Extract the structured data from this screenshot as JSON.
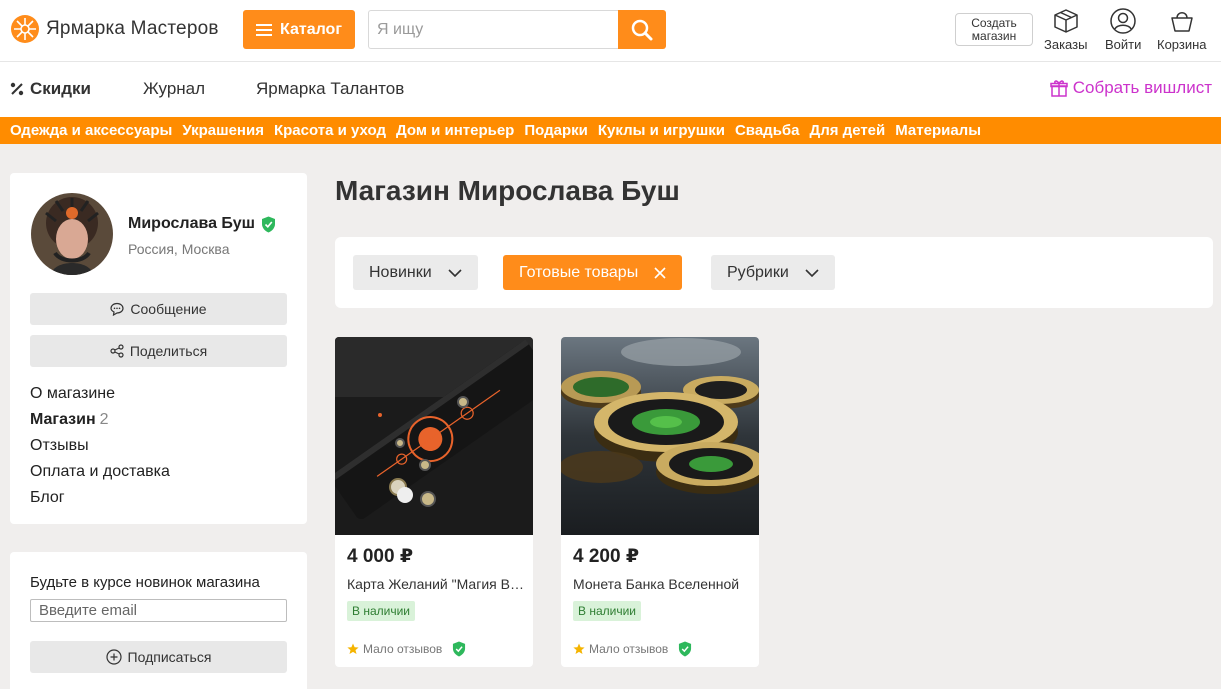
{
  "header": {
    "logo_text": "Ярмарка Мастеров",
    "catalog_label": "Каталог",
    "search_placeholder": "Я ищу",
    "create_shop_line1": "Создать",
    "create_shop_line2": "магазин",
    "orders_label": "Заказы",
    "login_label": "Войти",
    "cart_label": "Корзина",
    "accent_color": "#ff8c1a"
  },
  "nav": {
    "discounts": "Скидки",
    "journal": "Журнал",
    "talents": "Ярмарка Талантов",
    "wishlist": "Собрать вишлист"
  },
  "categories": [
    "Одежда и аксессуары",
    "Украшения",
    "Красота и уход",
    "Дом и интерьер",
    "Подарки",
    "Куклы и игрушки",
    "Свадьба",
    "Для детей",
    "Материалы"
  ],
  "seller": {
    "name": "Мирослава Буш",
    "location": "Россия, Москва",
    "message_label": "Сообщение",
    "share_label": "Поделиться"
  },
  "menu": {
    "about": "О магазине",
    "shop": "Магазин",
    "shop_count": "2",
    "reviews": "Отзывы",
    "payment": "Оплата и доставка",
    "blog": "Блог"
  },
  "subscribe": {
    "title": "Будьте в курсе новинок магазина",
    "email_placeholder": "Введите email",
    "button_label": "Подписаться"
  },
  "main": {
    "title": "Магазин Мирослава Буш",
    "filters": {
      "new": "Новинки",
      "ready": "Готовые товары",
      "sections": "Рубрики"
    }
  },
  "products": [
    {
      "price": "4 000 ₽",
      "name": "Карта Желаний \"Магия Вселенной\"",
      "stock": "В наличии",
      "reviews": "Мало отзывов"
    },
    {
      "price": "4 200 ₽",
      "name": "Монета Банка Вселенной",
      "stock": "В наличии",
      "reviews": "Мало отзывов"
    }
  ]
}
